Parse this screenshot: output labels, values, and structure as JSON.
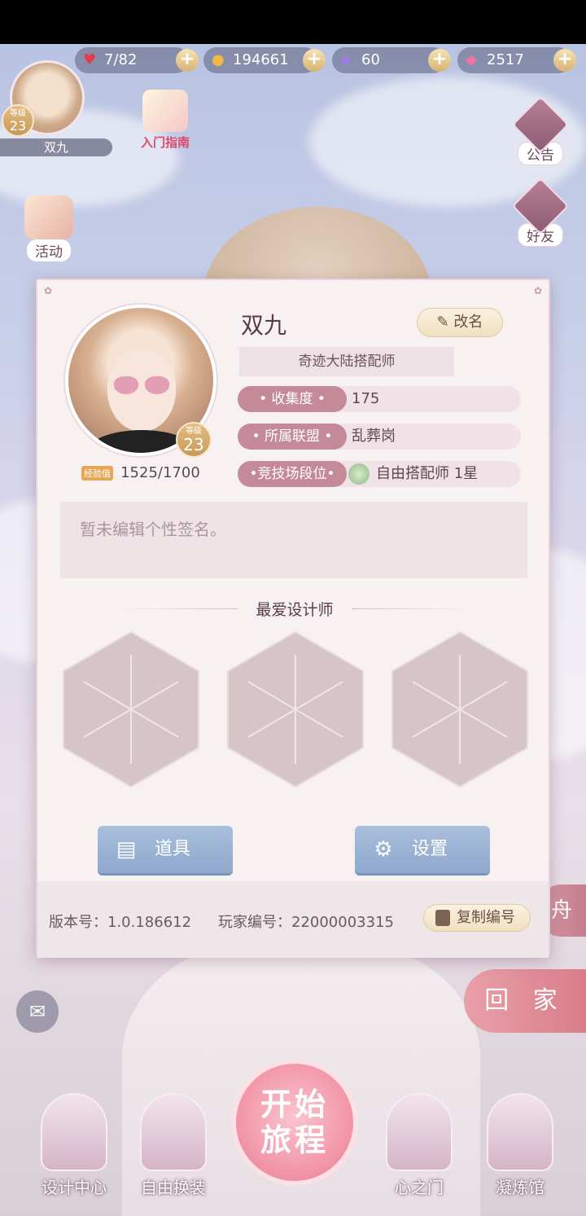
{
  "resources": {
    "stamina": "7/82",
    "gold": "194661",
    "diamond_purple": "60",
    "diamond_pink": "2517"
  },
  "player": {
    "avatar_level_label": "等级",
    "level": "23",
    "name": "双九"
  },
  "top_buttons": {
    "guide": "入门指南",
    "activity": "活动",
    "notice": "公告",
    "friends": "好友"
  },
  "side_partial": {
    "home": "回 家",
    "boat": "舟"
  },
  "profile": {
    "name": "双九",
    "rename": "改名",
    "title": "奇迹大陆搭配师",
    "level_label": "等级",
    "level": "23",
    "exp_tag": "经验值",
    "exp": "1525/1700",
    "rows": [
      {
        "key": "• 收集度 •",
        "value": "175"
      },
      {
        "key": "• 所属联盟 •",
        "value": "乱葬岗"
      },
      {
        "key": "•竞技场段位•",
        "value": "自由搭配师 1星"
      }
    ],
    "signature": "暂未编辑个性签名。",
    "favorite_title": "最爱设计师",
    "items_button": "道具",
    "settings_button": "设置",
    "version": "版本号：1.0.186612",
    "player_id": "玩家编号：22000003315",
    "copy_button": "复制编号"
  },
  "bottom_nav": {
    "design": "设计中心",
    "dress": "自由换装",
    "start_l1": "开始",
    "start_l2": "旅程",
    "heart": "心之门",
    "refine": "凝炼馆"
  },
  "colors": {
    "accent_pink": "#c48a98",
    "button_blue": "#8ea8cc",
    "gold": "#d6b373"
  }
}
